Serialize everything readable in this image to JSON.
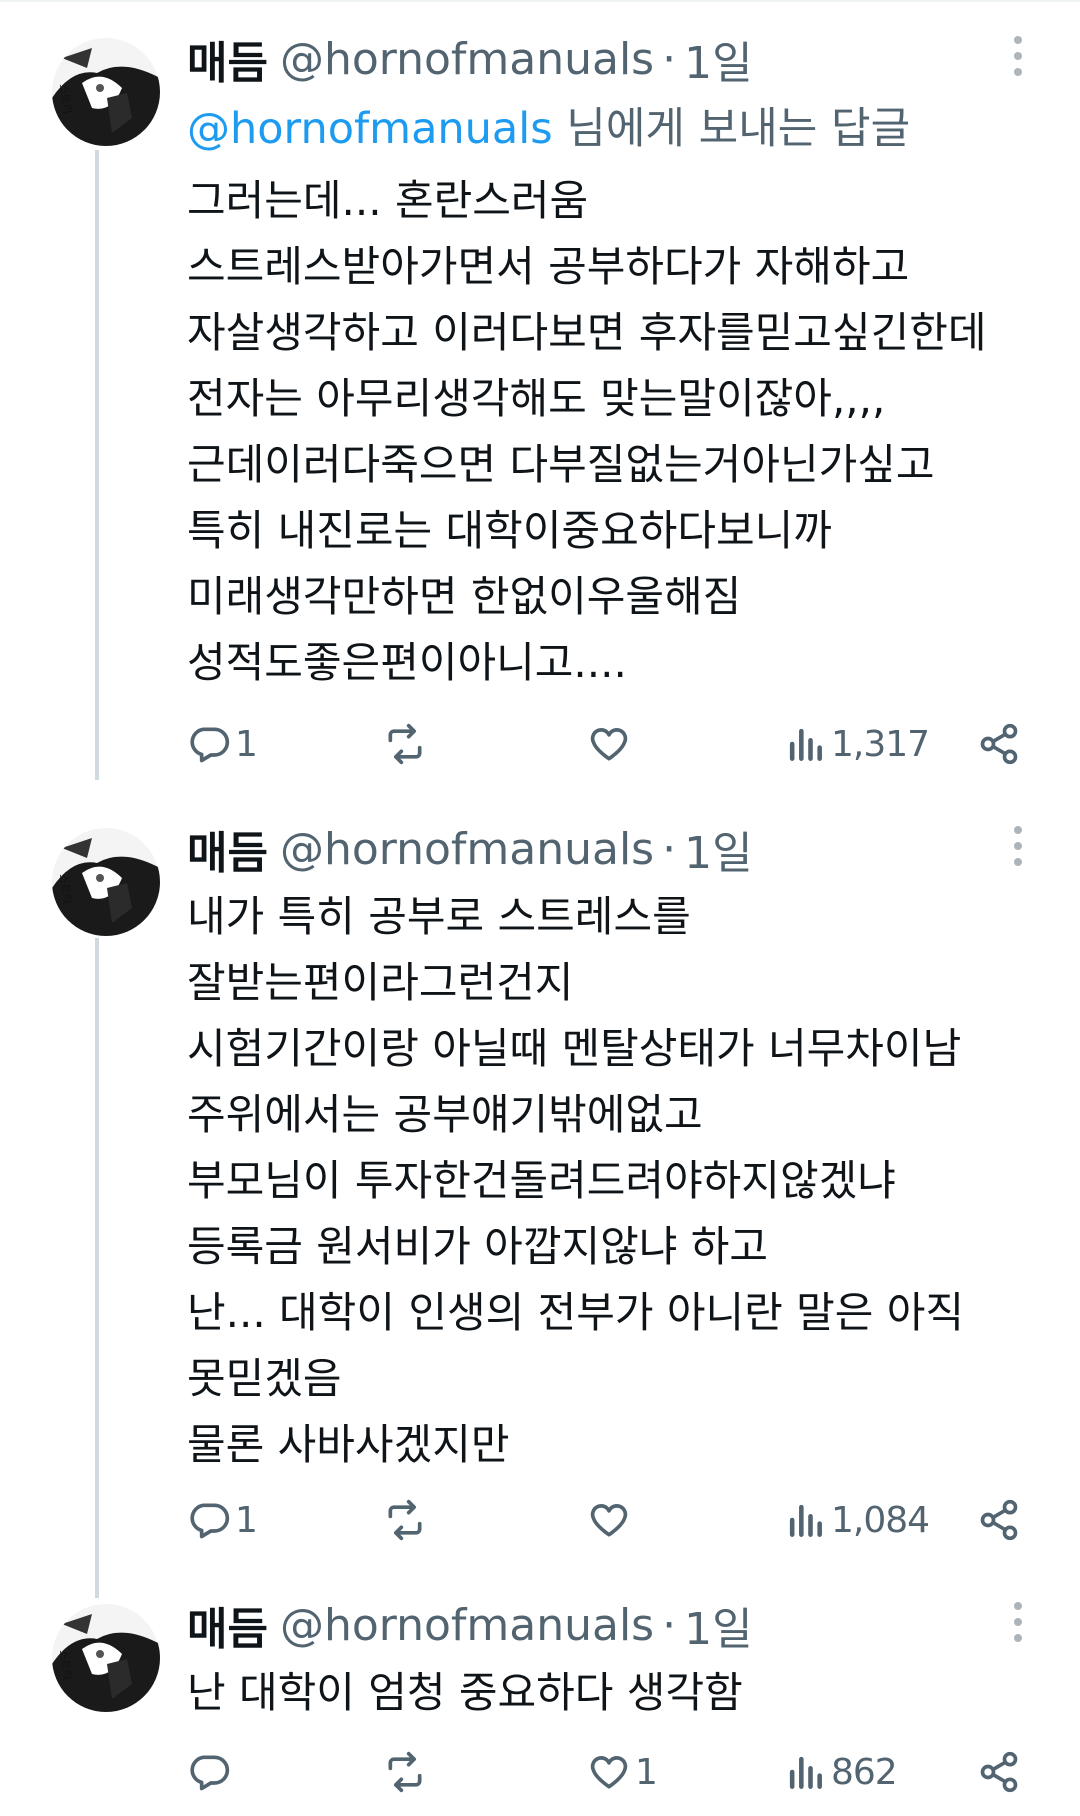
{
  "tweets": [
    {
      "author": {
        "name": "매듬",
        "handle": "@hornofmanuals",
        "dot": "·",
        "time": "1일"
      },
      "reply_to": {
        "mention": "@hornofmanuals",
        "suffix": " 님에게 보내는 답글"
      },
      "lines": [
        "그러는데... 혼란스러움",
        "스트레스받아가면서 공부하다가 자해하고",
        "자살생각하고 이러다보면 후자를믿고싶긴한데",
        "전자는 아무리생각해도 맞는말이잖아,,,,",
        "근데이러다죽으면 다부질없는거아닌가싶고",
        "특히 내진로는 대학이중요하다보니까",
        "미래생각만하면 한없이우울해짐",
        "성적도좋은편이아니고...."
      ],
      "stats": {
        "replies": "1",
        "retweets": "",
        "likes": "",
        "views": "1,317"
      }
    },
    {
      "author": {
        "name": "매듬",
        "handle": "@hornofmanuals",
        "dot": "·",
        "time": "1일"
      },
      "lines": [
        "내가 특히 공부로 스트레스를",
        "잘받는편이라그런건지",
        "시험기간이랑 아닐때 멘탈상태가 너무차이남",
        "주위에서는 공부얘기밖에없고",
        "부모님이 투자한건돌려드려야하지않겠냐",
        "등록금 원서비가 아깝지않냐 하고",
        "난... 대학이 인생의 전부가 아니란 말은 아직",
        "못믿겠음",
        "물론 사바사겠지만"
      ],
      "stats": {
        "replies": "1",
        "retweets": "",
        "likes": "",
        "views": "1,084"
      }
    },
    {
      "author": {
        "name": "매듬",
        "handle": "@hornofmanuals",
        "dot": "·",
        "time": "1일"
      },
      "lines": [
        "난 대학이 엄청 중요하다 생각함"
      ],
      "stats": {
        "replies": "",
        "retweets": "",
        "likes": "1",
        "views": "862"
      }
    }
  ],
  "icons": {
    "reply": "reply-icon",
    "retweet": "retweet-icon",
    "like": "heart-icon",
    "views": "views-icon",
    "share": "share-icon",
    "more": "more-dots-icon"
  },
  "colors": {
    "text": "#0f1419",
    "secondary": "#536471",
    "mention": "#1d9bf0",
    "thread_line": "#cfd9de"
  }
}
